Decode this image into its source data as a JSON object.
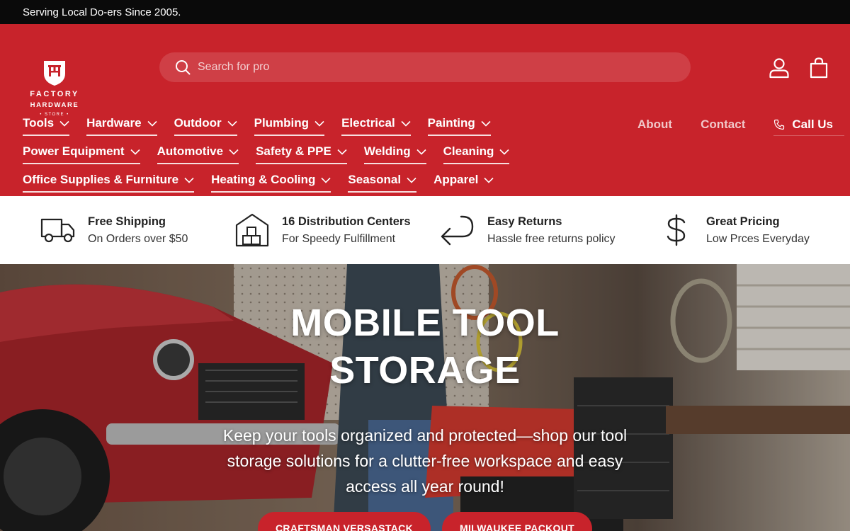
{
  "announcement": "Serving Local Do-ers Since 2005.",
  "logo": {
    "line1": "FACTORY",
    "line2": "HARDWARE",
    "line3": "• STORE •"
  },
  "search": {
    "placeholder": "Search for pro"
  },
  "nav": {
    "row1": [
      "Tools",
      "Hardware",
      "Outdoor",
      "Plumbing",
      "Electrical",
      "Painting"
    ],
    "row2": [
      "Power Equipment",
      "Automotive",
      "Safety & PPE",
      "Welding",
      "Cleaning"
    ],
    "row3": [
      "Office Supplies & Furniture",
      "Heating & Cooling",
      "Seasonal",
      "Apparel"
    ]
  },
  "links": {
    "about": "About",
    "contact": "Contact",
    "call": "Call Us"
  },
  "features": [
    {
      "title": "Free Shipping",
      "sub": "On Orders over $50",
      "icon": "truck-icon"
    },
    {
      "title": "16 Distribution Centers",
      "sub": "For Speedy Fulfillment",
      "icon": "warehouse-icon"
    },
    {
      "title": "Easy Returns",
      "sub": "Hassle free returns policy",
      "icon": "return-arrow-icon"
    },
    {
      "title": "Great Pricing",
      "sub": "Low Prces Everyday",
      "icon": "dollar-icon"
    }
  ],
  "hero": {
    "title_line1": "MOBILE TOOL",
    "title_line2": "STORAGE",
    "body": "Keep your tools organized and protected—shop our tool storage solutions for a clutter-free workspace and easy access all year round!",
    "button1": "CRAFTSMAN VERSASTACK",
    "button2": "MILWAUKEE PACKOUT"
  },
  "colors": {
    "brand_red": "#c8232b",
    "announce_bg": "#0a0a0a"
  }
}
